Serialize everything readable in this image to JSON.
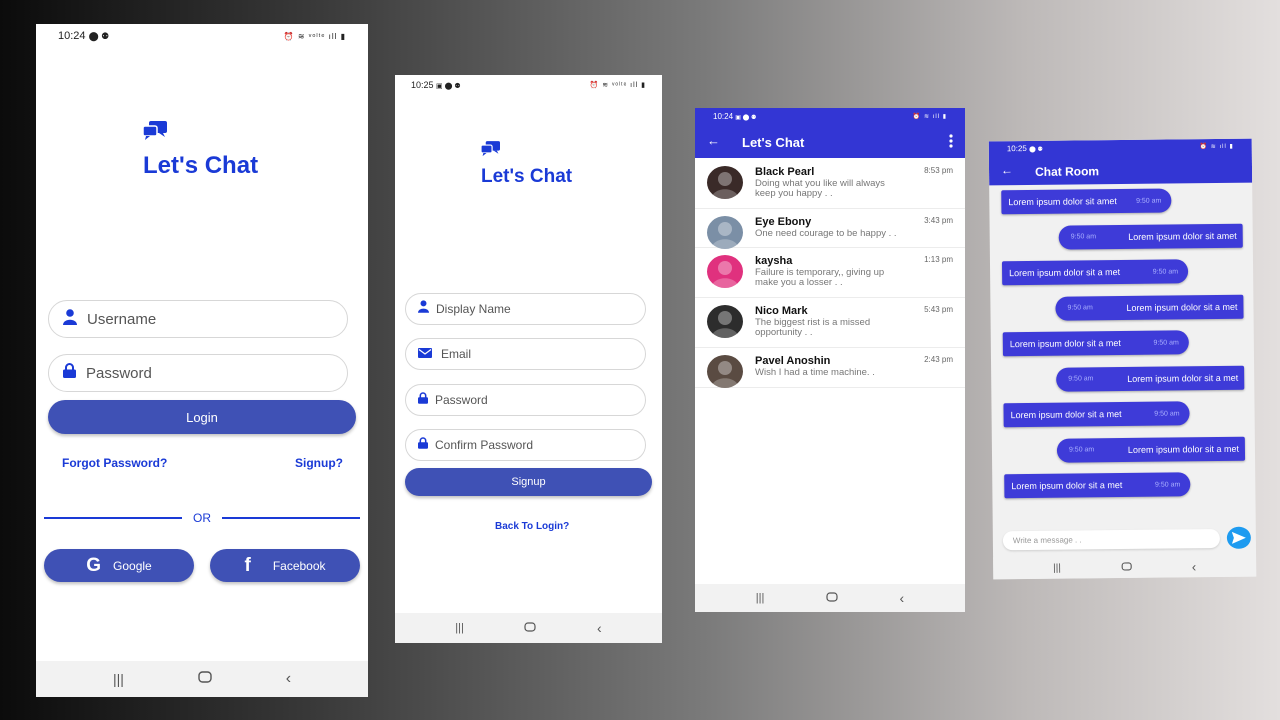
{
  "colors": {
    "brand": "#1a3ad6",
    "button": "#3f51b5",
    "header": "#3336d4",
    "bubble": "#3e3bd8"
  },
  "login": {
    "status": {
      "time": "10:24",
      "left_icons": "⬤ ⚉",
      "right_icons": "⏰ ≋ ᵛᵒˡᵗᵉ ıll ▮"
    },
    "app_title": "Let's Chat",
    "username_placeholder": "Username",
    "password_placeholder": "Password",
    "login_label": "Login",
    "forgot_label": "Forgot Password?",
    "signup_link_label": "Signup?",
    "or_label": "OR",
    "google_label": "Google",
    "facebook_label": "Facebook"
  },
  "signup": {
    "status": {
      "time": "10:25",
      "left_icons": "▣ ⬤ ⚉",
      "right_icons": "⏰ ≋ ᵛᵒˡᵗᵉ ıll ▮"
    },
    "app_title": "Let's Chat",
    "display_name_placeholder": "Display Name",
    "email_placeholder": "Email",
    "password_placeholder": "Password",
    "confirm_placeholder": "Confirm Password",
    "signup_label": "Signup",
    "back_label": "Back To Login?"
  },
  "chats": {
    "status": {
      "time": "10:24",
      "left_icons": "▣ ⬤ ⚉",
      "right_icons": "⏰ ≋ ıll ▮"
    },
    "title": "Let's Chat",
    "items": [
      {
        "name": "Black Pearl",
        "message": "Doing what you like will always keep you happy . .",
        "time": "8:53 pm",
        "avatar_color": "#3a2a28"
      },
      {
        "name": "Eye Ebony",
        "message": "One need courage to be happy . .",
        "time": "3:43 pm",
        "avatar_color": "#7b8fa6"
      },
      {
        "name": "kaysha",
        "message": "Failure is temporary,, giving up make you a losser . .",
        "time": "1:13 pm",
        "avatar_color": "#e0317e"
      },
      {
        "name": "Nico Mark",
        "message": "The biggest rist is a missed opportunity . .",
        "time": "5:43 pm",
        "avatar_color": "#2d2d2d"
      },
      {
        "name": "Pavel Anoshin",
        "message": "Wish I had a time machine. .",
        "time": "2:43 pm",
        "avatar_color": "#5a4b42"
      }
    ]
  },
  "room": {
    "status": {
      "time": "10:25",
      "left_icons": "⬤ ⚉",
      "right_icons": "⏰ ≋ ıll ▮"
    },
    "title": "Chat Room",
    "messages": [
      {
        "text": "Lorem ipsum dolor sit amet",
        "time": "9:50 am",
        "side": "left"
      },
      {
        "text": "Lorem ipsum dolor sit amet",
        "time": "9:50 am",
        "side": "right"
      },
      {
        "text": "Lorem ipsum dolor sit a met",
        "time": "9:50 am",
        "side": "left"
      },
      {
        "text": "Lorem ipsum dolor sit a met",
        "time": "9:50 am",
        "side": "right"
      },
      {
        "text": "Lorem ipsum dolor sit a met",
        "time": "9:50 am",
        "side": "left"
      },
      {
        "text": "Lorem ipsum dolor sit a met",
        "time": "9:50 am",
        "side": "right"
      },
      {
        "text": "Lorem ipsum dolor sit a met",
        "time": "9:50 am",
        "side": "left"
      },
      {
        "text": "Lorem ipsum dolor sit a met",
        "time": "9:50 am",
        "side": "right"
      },
      {
        "text": "Lorem ipsum dolor sit a met",
        "time": "9:50 am",
        "side": "left"
      }
    ],
    "input_placeholder": "Write a message . ."
  }
}
